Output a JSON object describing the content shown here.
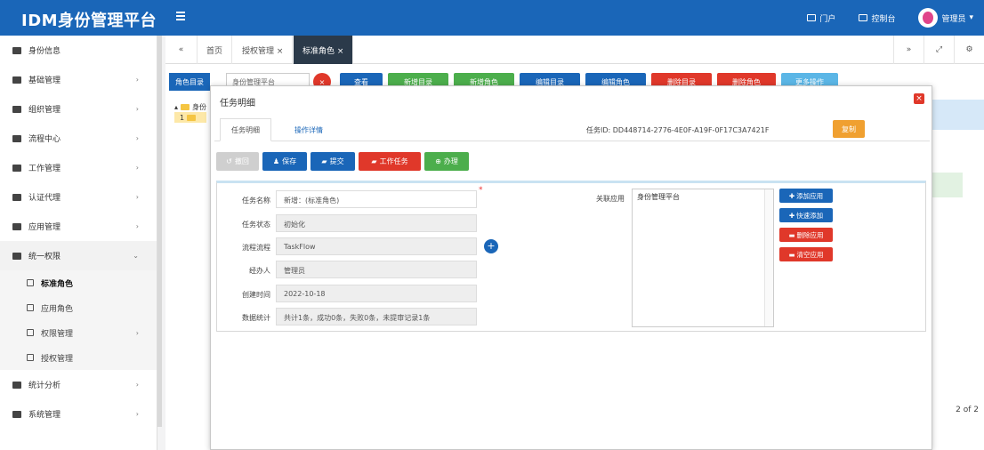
{
  "app": {
    "title": "IDM身份管理平台"
  },
  "topbar": {
    "portal_label": "门户",
    "workbench_label": "控制台",
    "user_label": "管理员"
  },
  "sidebar": {
    "items": [
      {
        "label": "身份信息"
      },
      {
        "label": "基础管理"
      },
      {
        "label": "组织管理"
      },
      {
        "label": "流程中心"
      },
      {
        "label": "工作管理"
      },
      {
        "label": "认证代理"
      },
      {
        "label": "应用管理"
      },
      {
        "label": "统一权限"
      }
    ],
    "subitems": [
      {
        "label": "标准角色"
      },
      {
        "label": "应用角色"
      },
      {
        "label": "权限管理"
      },
      {
        "label": "授权管理"
      }
    ],
    "bottom_items": [
      {
        "label": "统计分析"
      },
      {
        "label": "系统管理"
      }
    ]
  },
  "tabs": [
    {
      "label": "首页"
    },
    {
      "label": "授权管理 ×"
    },
    {
      "label": "标准角色 ×"
    }
  ],
  "toolbar": {
    "role_dir": "角色目录",
    "search_placeholder": "身份管理平台",
    "buttons": [
      "查看",
      "新增目录",
      "新增角色",
      "编辑目录",
      "编辑角色",
      "删除目录",
      "删除角色",
      "更多操作"
    ]
  },
  "tree": {
    "root": "身份",
    "child": "1"
  },
  "pager": "2 of 2",
  "modal": {
    "title": "任务明细",
    "close": "×",
    "tabs": [
      "任务明细",
      "操作详情"
    ],
    "task_id_label": "任务ID:",
    "task_id": "DD448714-2776-4E0F-A19F-0F17C3A7421F",
    "copy_label": "复制",
    "buttons": [
      "撤回",
      "保存",
      "提交",
      "工作任务",
      "办理"
    ],
    "form": {
      "fields": [
        {
          "label": "任务名称",
          "value": "新增：(标准角色)"
        },
        {
          "label": "任务状态",
          "value": "初始化"
        },
        {
          "label": "流程流程",
          "value": "TaskFlow"
        },
        {
          "label": "经办人",
          "value": "管理员"
        },
        {
          "label": "创建时间",
          "value": "2022-10-18"
        },
        {
          "label": "数据统计",
          "value": "共计1条，成功0条，失败0条，未提审记录1条"
        }
      ],
      "app_label": "关联应用",
      "app_items": [
        "身份管理平台"
      ],
      "side_buttons": [
        "添加应用",
        "快速添加",
        "删除应用",
        "清空应用"
      ]
    }
  },
  "colors": {
    "primary": "#1a66b8",
    "danger": "#e0382a",
    "success": "#4cae4c",
    "warning": "#f0a030"
  }
}
